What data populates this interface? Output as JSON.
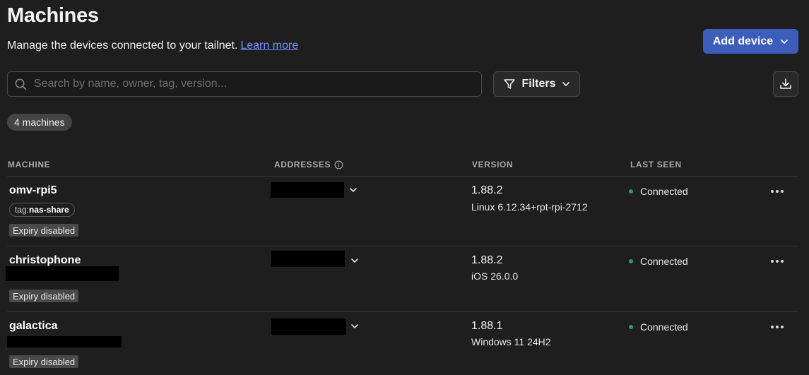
{
  "header": {
    "title": "Machines",
    "subtitle": "Manage the devices connected to your tailnet.",
    "learn_more": "Learn more",
    "add_device": "Add device"
  },
  "toolbar": {
    "search_placeholder": "Search by name, owner, tag, version...",
    "filters": "Filters"
  },
  "count": "4 machines",
  "columns": {
    "machine": "MACHINE",
    "addresses": "ADDRESSES",
    "version": "VERSION",
    "last_seen": "LAST SEEN"
  },
  "machines": [
    {
      "name": "omv-rpi5",
      "tag_prefix": "tag:",
      "tag_value": "nas-share",
      "expiry": "Expiry disabled",
      "version": "1.88.2",
      "os": "Linux 6.12.34+rpt-rpi-2712",
      "status": "Connected"
    },
    {
      "name": "christophone",
      "expiry": "Expiry disabled",
      "version": "1.88.2",
      "os": "iOS 26.0.0",
      "status": "Connected"
    },
    {
      "name": "galactica",
      "expiry": "Expiry disabled",
      "version": "1.88.1",
      "os": "Windows 11 24H2",
      "status": "Connected"
    }
  ],
  "colors": {
    "background": "#1f1e1e",
    "accent": "#3d5dbb",
    "link": "#6f94ff",
    "connected": "#2a9d6a"
  }
}
